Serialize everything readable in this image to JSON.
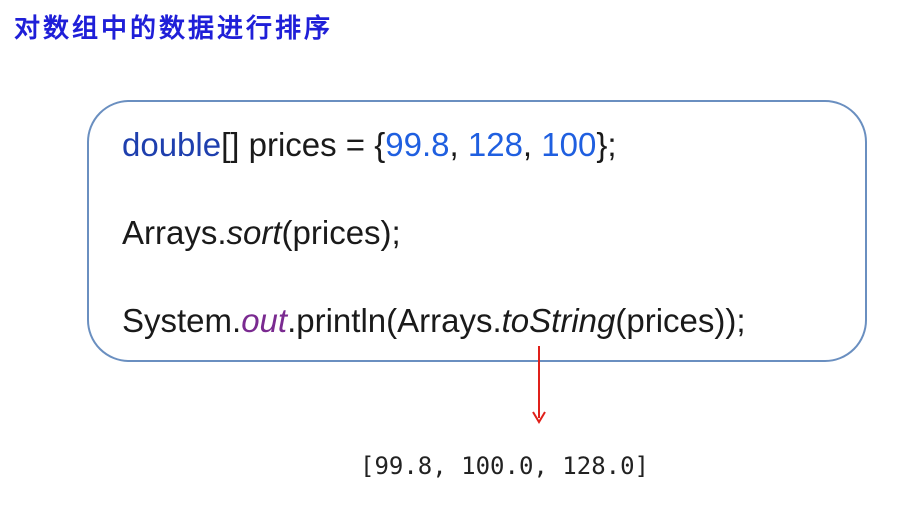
{
  "title": "对数组中的数据进行排序",
  "code": {
    "line1": {
      "kw": "double",
      "rest": "[] prices = {",
      "n1": "99.8",
      "sep1": ", ",
      "n2": "128",
      "sep2": ", ",
      "n3": "100",
      "end": "};"
    },
    "line2": {
      "cls": "Arrays.",
      "method": "sort",
      "args": "(prices);"
    },
    "line3": {
      "cls": "System.",
      "field": "out",
      "mid": ".println(Arrays.",
      "method": "toString",
      "args": "(prices));"
    }
  },
  "output": "[99.8, 100.0, 128.0]",
  "colors": {
    "title": "#1f1fd8",
    "box_border": "#6a8fc0",
    "arrow": "#e0201a"
  }
}
